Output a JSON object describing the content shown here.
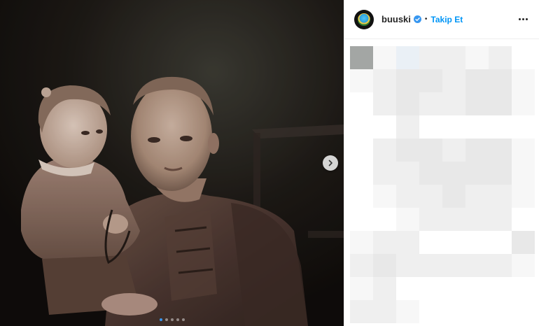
{
  "account": {
    "username": "buuski",
    "verified": true,
    "separator": "•",
    "follow_label": "Takip Et"
  },
  "media": {
    "carousel_dot_count": 5,
    "active_dot": 0
  },
  "icons": {
    "verified": "verified-badge-icon",
    "more": "more-options-icon",
    "next": "chevron-right-icon"
  },
  "colors": {
    "follow_blue": "#0095f6",
    "active_dot": "#3897f0",
    "pixelation": [
      "#ffffff",
      "#f7f7f7",
      "#efefef",
      "#e8e8e8",
      "#e0e0e0",
      "#a3a6a4",
      "#eaf0f6"
    ]
  },
  "comments_pixelated": [
    [
      5,
      1,
      6,
      2,
      2,
      1,
      2,
      0
    ],
    [
      1,
      2,
      3,
      3,
      2,
      3,
      3,
      1
    ],
    [
      0,
      2,
      3,
      2,
      2,
      3,
      3,
      1
    ],
    [
      0,
      0,
      2,
      0,
      0,
      0,
      0,
      0
    ],
    [
      0,
      2,
      3,
      3,
      2,
      3,
      3,
      1
    ],
    [
      0,
      2,
      2,
      3,
      3,
      3,
      3,
      1
    ],
    [
      0,
      1,
      2,
      2,
      3,
      2,
      2,
      1
    ],
    [
      0,
      0,
      1,
      2,
      2,
      2,
      2,
      0
    ],
    [
      1,
      2,
      2,
      0,
      0,
      0,
      0,
      3
    ],
    [
      2,
      3,
      2,
      2,
      2,
      2,
      2,
      1
    ],
    [
      1,
      2,
      0,
      0,
      0,
      0,
      0,
      0
    ],
    [
      2,
      2,
      1,
      0,
      0,
      0,
      0,
      0
    ]
  ]
}
